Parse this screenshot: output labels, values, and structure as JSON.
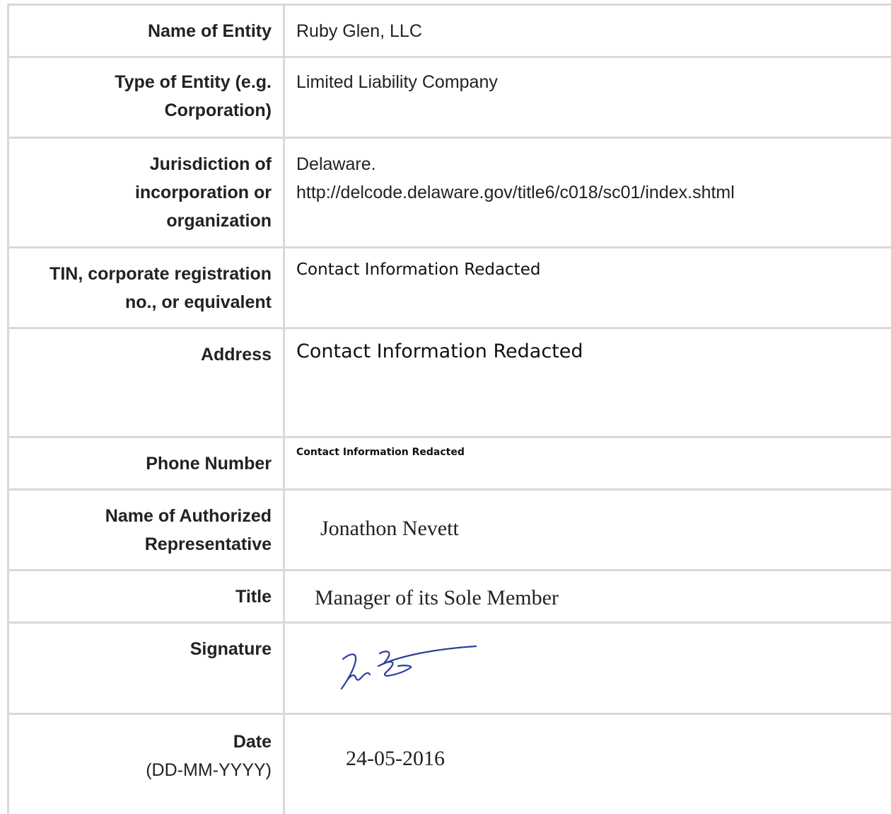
{
  "rows": {
    "entity_name": {
      "label": "Name of Entity",
      "value": "Ruby Glen, LLC"
    },
    "entity_type": {
      "label": "Type of Entity (e.g. Corporation)",
      "value": "Limited Liability Company"
    },
    "jurisdiction": {
      "label": "Jurisdiction of incorporation or organization",
      "value_line1": "Delaware.",
      "value_line2": "http://delcode.delaware.gov/title6/c018/sc01/index.shtml"
    },
    "tin": {
      "label": "TIN, corporate registration no., or equivalent",
      "value": "Contact Information Redacted"
    },
    "address": {
      "label": "Address",
      "value": "Contact Information Redacted"
    },
    "phone": {
      "label": "Phone Number",
      "value": "Contact Information Redacted"
    },
    "representative": {
      "label": "Name of Authorized Representative",
      "value": "Jonathon Nevett"
    },
    "title": {
      "label": "Title",
      "value": "Manager of its Sole Member"
    },
    "signature": {
      "label": "Signature"
    },
    "date": {
      "label": "Date",
      "label_sub": "(DD-MM-YYYY)",
      "value": "24-05-2016"
    }
  },
  "colors": {
    "border": "#d9d9d9",
    "signature_ink": "#2b3f9e"
  }
}
